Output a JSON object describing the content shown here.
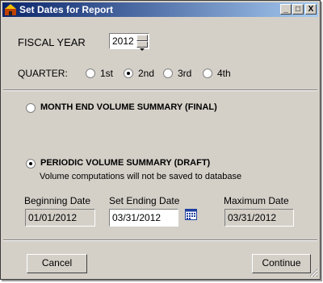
{
  "window": {
    "title": "Set Dates for Report",
    "title_gradient": [
      "#0a246a",
      "#a6caf0"
    ]
  },
  "title_buttons": {
    "minimize": "_",
    "maximize": "□",
    "close": "X"
  },
  "fiscal_year": {
    "label": "FISCAL YEAR",
    "value": "2012"
  },
  "quarter": {
    "label": "QUARTER:",
    "options": [
      "1st",
      "2nd",
      "3rd",
      "4th"
    ],
    "selected": "2nd"
  },
  "report_type": {
    "month_end_label": "MONTH END VOLUME SUMMARY (FINAL)",
    "periodic_label": "PERIODIC VOLUME SUMMARY (DRAFT)",
    "periodic_note": "Volume computations will not be saved to database",
    "selected": "periodic"
  },
  "dates": {
    "beginning_label": "Beginning Date",
    "beginning_value": "01/01/2012",
    "ending_label": "Set Ending Date",
    "ending_value": "03/31/2012",
    "maximum_label": "Maximum Date",
    "maximum_value": "03/31/2012"
  },
  "buttons": {
    "cancel": "Cancel",
    "continue": "Continue"
  }
}
